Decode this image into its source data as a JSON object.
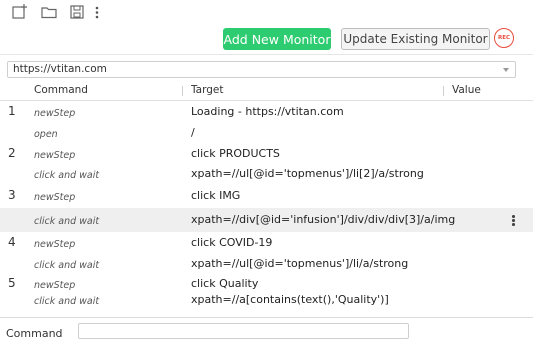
{
  "toolbar": {
    "icons": [
      "new-test-icon",
      "open-folder-icon",
      "save-icon",
      "more-vertical-icon"
    ]
  },
  "actions": {
    "add_label": "Add New Monitor",
    "update_label": "Update Existing Monitor",
    "rec_label": "REC",
    "add_color": "#2ecc71",
    "rec_color": "#e74c3c"
  },
  "base_url": "https://vtitan.com",
  "columns": {
    "command": "Command",
    "target": "Target",
    "value": "Value"
  },
  "rows": [
    {
      "num": "1",
      "command": "newStep",
      "target": "Loading - https://vtitan.com"
    },
    {
      "num": "",
      "command": "open",
      "target": "/"
    },
    {
      "num": "2",
      "command": "newStep",
      "target": "click PRODUCTS"
    },
    {
      "num": "",
      "command": "click and wait",
      "target": "xpath=//ul[@id='topmenus']/li[2]/a/strong"
    },
    {
      "num": "3",
      "command": "newStep",
      "target": "click IMG"
    },
    {
      "num": "",
      "command": "click and wait",
      "target": "xpath=//div[@id='infusion']/div/div/div[3]/a/img"
    },
    {
      "num": "4",
      "command": "newStep",
      "target": "click COVID-19"
    },
    {
      "num": "",
      "command": "click and wait",
      "target": "xpath=//ul[@id='topmenus']/li/a/strong"
    },
    {
      "num": "5",
      "command": "newStep",
      "target": "click Quality"
    },
    {
      "num": "",
      "command": "click and wait",
      "target": "xpath=//a[contains(text(),'Quality')]"
    }
  ],
  "footer": {
    "command_label": "Command"
  }
}
